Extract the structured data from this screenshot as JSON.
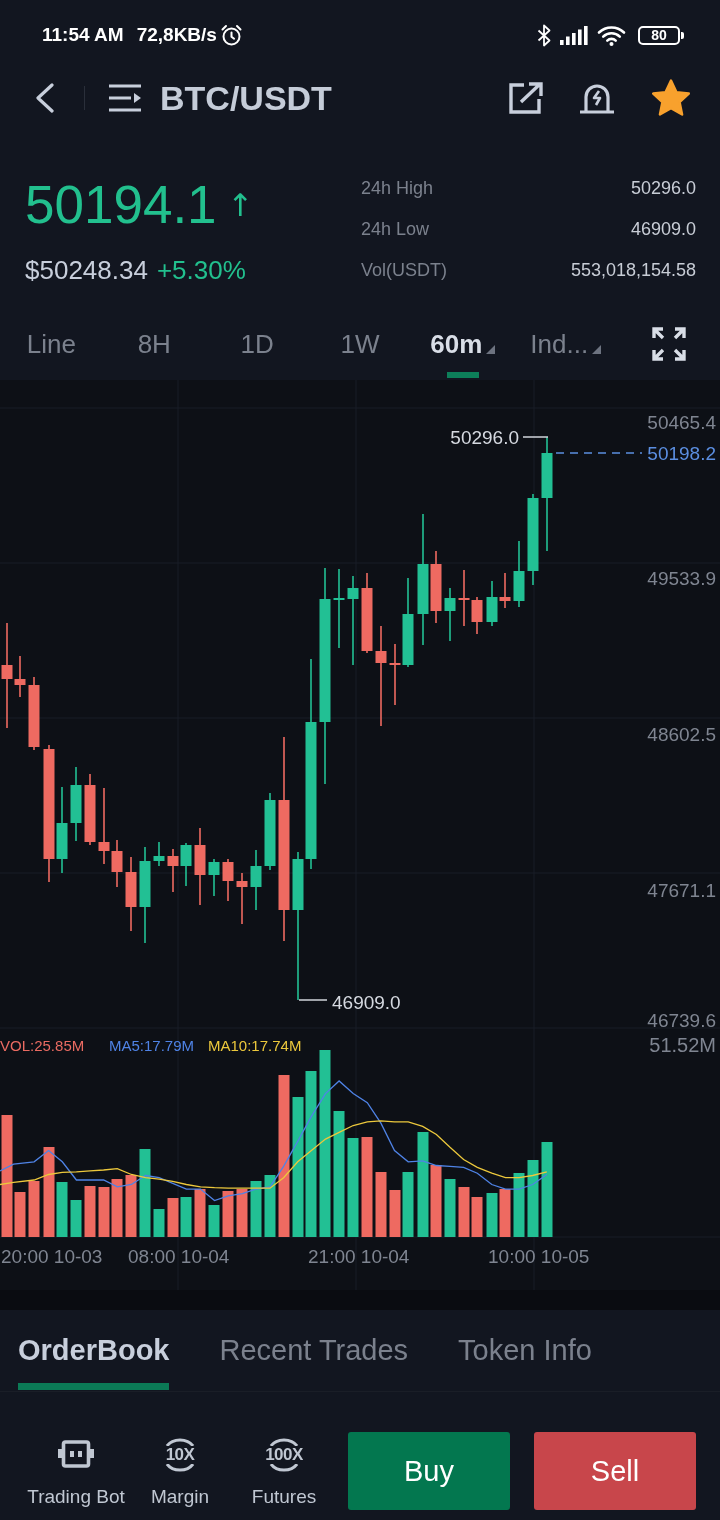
{
  "status_bar": {
    "time": "11:54 AM",
    "network_speed": "72,8KB/s",
    "battery": "80"
  },
  "header": {
    "title": "BTC/USDT",
    "favorite": true
  },
  "ticker": {
    "last_price": "50194.1",
    "trend_arrow": "↑",
    "usd_price": "$50248.34",
    "change": "+5.30%",
    "stats": [
      {
        "label": "24h High",
        "value": "50296.0"
      },
      {
        "label": "24h Low",
        "value": "46909.0"
      },
      {
        "label": "Vol(USDT)",
        "value": "553,018,154.58"
      }
    ]
  },
  "intervals": [
    {
      "label": "Line",
      "selected": false,
      "dropdown": false
    },
    {
      "label": "8H",
      "selected": false,
      "dropdown": false
    },
    {
      "label": "1D",
      "selected": false,
      "dropdown": false
    },
    {
      "label": "1W",
      "selected": false,
      "dropdown": false
    },
    {
      "label": "60m",
      "selected": true,
      "dropdown": true
    },
    {
      "label": "Ind...",
      "selected": false,
      "dropdown": true
    }
  ],
  "chart": {
    "price_axis": [
      "50465.4",
      "49533.9",
      "48602.5",
      "47671.1",
      "46739.6"
    ],
    "high_marker": "50296.0",
    "current_price": "50198.2",
    "low_marker": "46909.0",
    "volume_legend": [
      {
        "label": "VOL:25.85M",
        "color": "#ea6b62"
      },
      {
        "label": "MA5:17.79M",
        "color": "#4f83e6"
      },
      {
        "label": "MA10:17.74M",
        "color": "#ecc83c"
      }
    ],
    "volume_axis": "51.52M",
    "time_axis": [
      "20:00 10-03",
      "08:00 10-04",
      "21:00 10-04",
      "10:00 10-05"
    ]
  },
  "detail_tabs": [
    {
      "label": "OrderBook",
      "selected": true
    },
    {
      "label": "Recent Trades",
      "selected": false
    },
    {
      "label": "Token Info",
      "selected": false
    }
  ],
  "shortcuts": [
    {
      "label": "Trading Bot",
      "kind": "bot"
    },
    {
      "label": "Margin",
      "kind": "leverage",
      "badge": "10X"
    },
    {
      "label": "Futures",
      "kind": "leverage",
      "badge": "100X"
    }
  ],
  "trade_buttons": [
    {
      "label": "Buy",
      "kind": "buy"
    },
    {
      "label": "Sell",
      "kind": "sell"
    }
  ]
}
